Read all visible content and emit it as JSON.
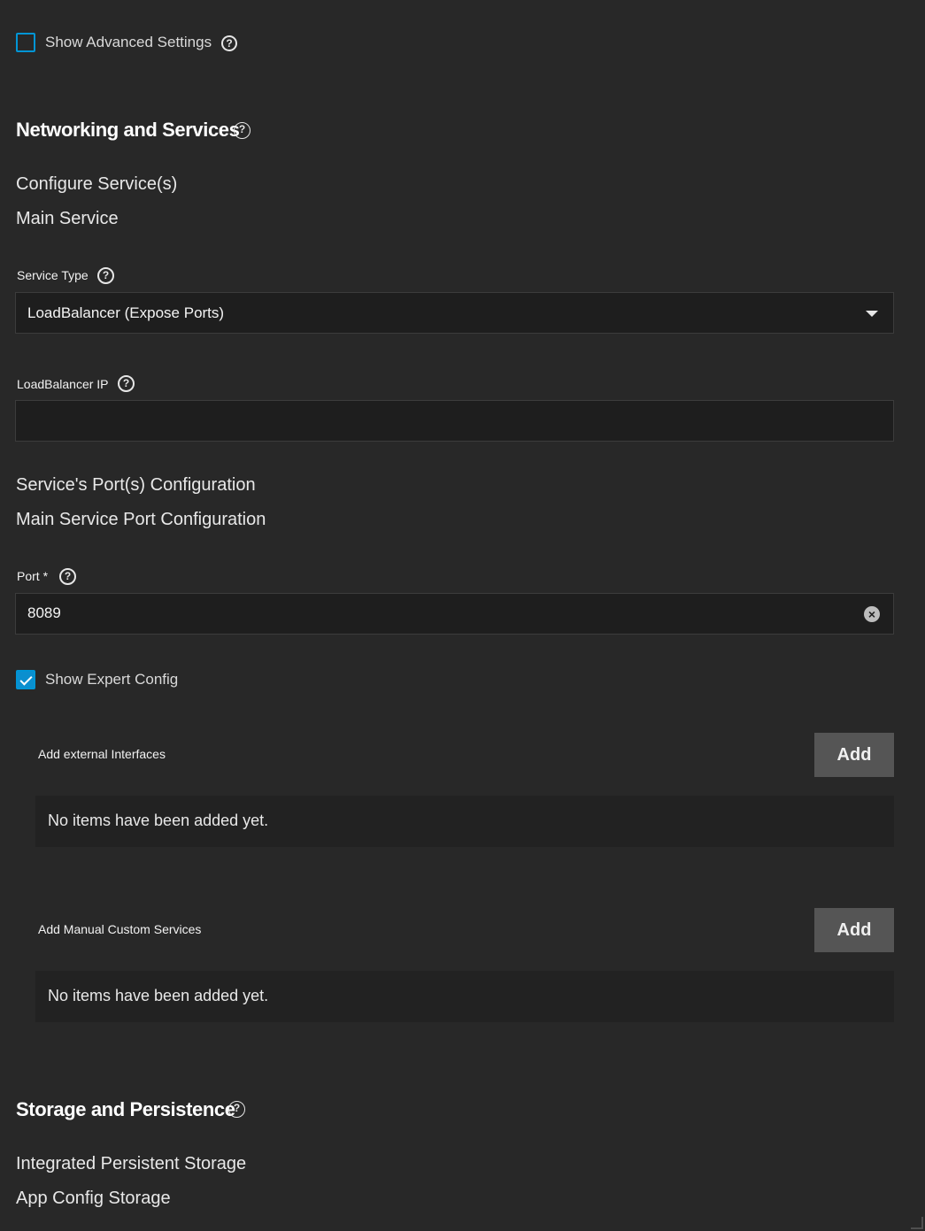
{
  "advanced": {
    "label": "Show Advanced Settings",
    "checked": false
  },
  "networking": {
    "title": "Networking and Services",
    "configure_services": "Configure Service(s)",
    "main_service": "Main Service",
    "service_type": {
      "label": "Service Type",
      "value": "LoadBalancer (Expose Ports)"
    },
    "loadbalancer_ip": {
      "label": "LoadBalancer IP",
      "value": ""
    },
    "ports_config": "Service's Port(s) Configuration",
    "main_port_config": "Main Service Port Configuration",
    "port": {
      "label": "Port",
      "required_marker": "*",
      "value": "8089"
    },
    "expert": {
      "label": "Show Expert Config",
      "checked": true
    },
    "external_interfaces": {
      "label": "Add external Interfaces",
      "add_label": "Add",
      "empty_text": "No items have been added yet."
    },
    "custom_services": {
      "label": "Add Manual Custom Services",
      "add_label": "Add",
      "empty_text": "No items have been added yet."
    }
  },
  "storage": {
    "title": "Storage and Persistence",
    "integrated": "Integrated Persistent Storage",
    "app_config": "App Config Storage"
  },
  "icons": {
    "help": "help-circle-icon",
    "dropdown": "chevron-down-icon",
    "clear": "clear-circle-icon",
    "check": "check-icon"
  },
  "colors": {
    "background": "#282828",
    "accent": "#0095d5",
    "button": "#555555",
    "field": "#1e1e1e"
  }
}
